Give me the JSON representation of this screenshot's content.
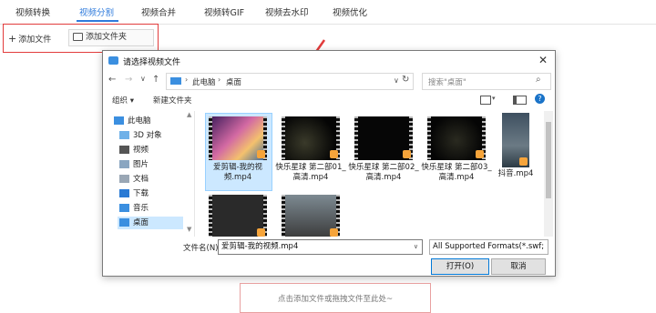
{
  "app_tabs": [
    {
      "label": "视频转换",
      "active": false
    },
    {
      "label": "视频分割",
      "active": true
    },
    {
      "label": "视频合并",
      "active": false
    },
    {
      "label": "视频转GIF",
      "active": false
    },
    {
      "label": "视频去水印",
      "active": false
    },
    {
      "label": "视频优化",
      "active": false
    }
  ],
  "toolbar": {
    "add_file": "添加文件",
    "add_folder": "添加文件夹"
  },
  "dialog": {
    "title": "请选择视频文件",
    "address": {
      "root": "此电脑",
      "current": "桌面"
    },
    "search_placeholder": "搜索\"桌面\"",
    "organize": "组织 ▾",
    "new_folder": "新建文件夹",
    "tree": [
      {
        "label": "此电脑",
        "icon": "computer-icon"
      },
      {
        "label": "3D 对象",
        "icon": "cube-icon"
      },
      {
        "label": "视频",
        "icon": "video-folder-icon"
      },
      {
        "label": "图片",
        "icon": "picture-folder-icon"
      },
      {
        "label": "文档",
        "icon": "document-folder-icon"
      },
      {
        "label": "下载",
        "icon": "download-folder-icon"
      },
      {
        "label": "音乐",
        "icon": "music-folder-icon"
      },
      {
        "label": "桌面",
        "icon": "desktop-folder-icon",
        "selected": true
      }
    ],
    "files": [
      {
        "name": "爱剪辑-我的视频.mp4",
        "selected": true
      },
      {
        "name": "快乐星球 第二部01_高清.mp4"
      },
      {
        "name": "快乐星球 第二部02_高清.mp4"
      },
      {
        "name": "快乐星球 第二部03_高清.mp4"
      },
      {
        "name": "抖音.mp4"
      },
      {
        "name": ""
      },
      {
        "name": ""
      }
    ],
    "filename_label": "文件名(N):",
    "filename_value": "爱剪辑-我的视频.mp4",
    "filter_value": "All Supported Formats(*.swf;",
    "open": "打开(O)",
    "cancel": "取消"
  },
  "drop_hint": "点击添加文件或拖拽文件至此处~",
  "colors": {
    "accent": "#2f7bdc",
    "highlight": "#e23c3c",
    "selection": "#cce8ff"
  }
}
